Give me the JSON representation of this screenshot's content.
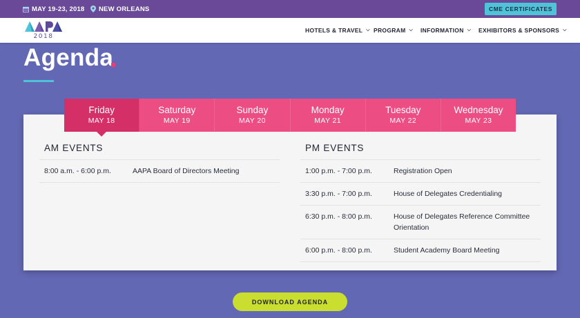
{
  "topbar": {
    "date": "MAY 19-23, 2018",
    "location": "NEW ORLEANS",
    "cme_label": "CME CERTIFICATES",
    "bg_color": "#6a4a98",
    "cme_color": "#4fc4d9"
  },
  "logo": {
    "text": "AAPA",
    "year": "2018"
  },
  "nav": {
    "items": [
      {
        "label": "HOTELS & TRAVEL"
      },
      {
        "label": "PROGRAM"
      },
      {
        "label": "INFORMATION"
      },
      {
        "label": "EXHIBITORS & SPONSORS"
      }
    ]
  },
  "page": {
    "title": "Agenda",
    "accent_color": "#ea3d7b",
    "bg_color": "#6368b4"
  },
  "tabs": [
    {
      "day": "Friday",
      "date": "MAY 18",
      "active": true
    },
    {
      "day": "Saturday",
      "date": "MAY 19",
      "active": false
    },
    {
      "day": "Sunday",
      "date": "MAY 20",
      "active": false
    },
    {
      "day": "Monday",
      "date": "MAY 21",
      "active": false
    },
    {
      "day": "Tuesday",
      "date": "MAY 22",
      "active": false
    },
    {
      "day": "Wednesday",
      "date": "MAY 23",
      "active": false
    }
  ],
  "am_events": {
    "heading": "AM EVENTS",
    "rows": [
      {
        "time": "8:00 a.m. - 6:00 p.m.",
        "name": "AAPA Board of Directors Meeting"
      }
    ]
  },
  "pm_events": {
    "heading": "PM EVENTS",
    "rows": [
      {
        "time": "1:00 p.m. - 7:00 p.m.",
        "name": "Registration Open"
      },
      {
        "time": "3:30 p.m. - 7:00 p.m.",
        "name": "House of Delegates Credentialing"
      },
      {
        "time": "6:30 p.m. - 8:00 p.m.",
        "name": "House of Delegates Reference Committee Orientation"
      },
      {
        "time": "6:00 p.m. - 8:00 p.m.",
        "name": "Student Academy Board Meeting"
      }
    ]
  },
  "download": {
    "label": "DOWNLOAD AGENDA",
    "color": "#c9de2e"
  }
}
